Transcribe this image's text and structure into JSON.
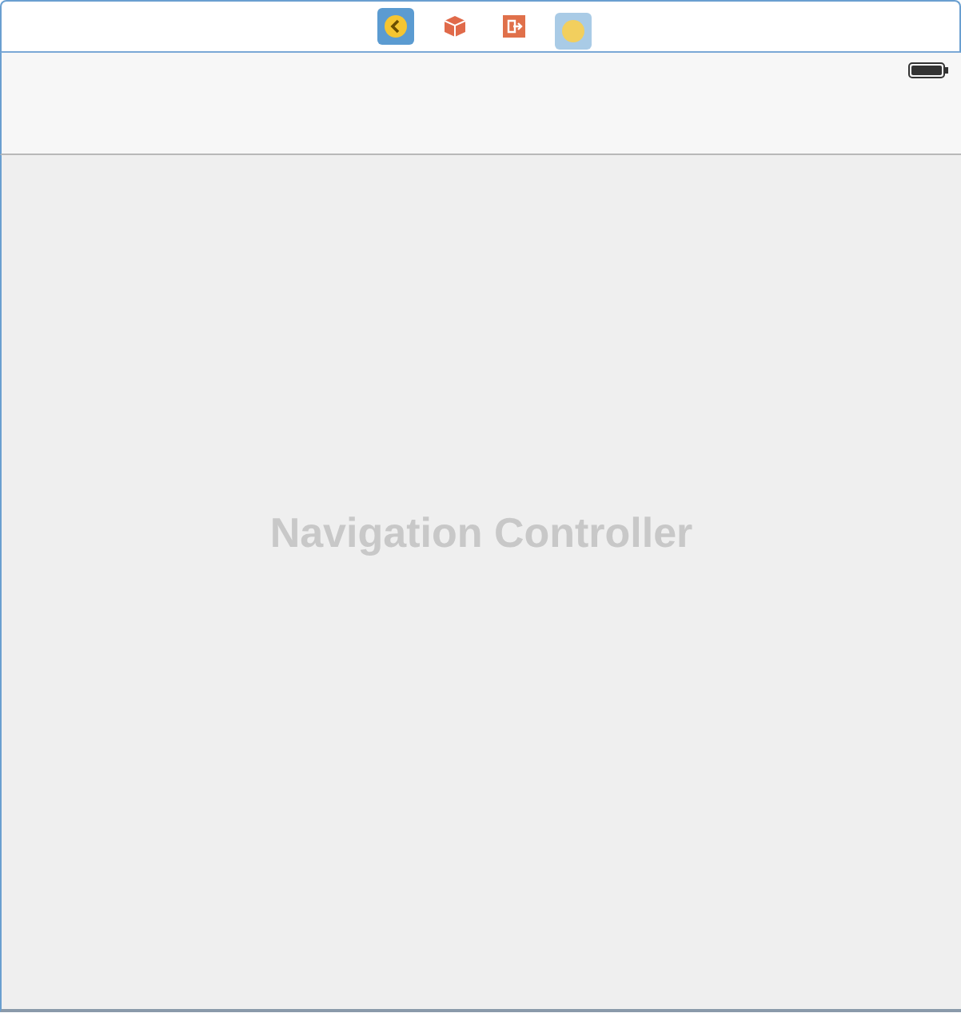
{
  "scene_dock": {
    "icons": [
      {
        "kind": "controller",
        "selected": true,
        "hovered": false
      },
      {
        "kind": "cube",
        "selected": false,
        "hovered": false
      },
      {
        "kind": "exit",
        "selected": false,
        "hovered": false
      },
      {
        "kind": "placeholder",
        "selected": false,
        "hovered": true
      }
    ]
  },
  "navigation_bar": {
    "battery": {
      "level": 1
    }
  },
  "canvas": {
    "title": "Navigation Controller"
  }
}
